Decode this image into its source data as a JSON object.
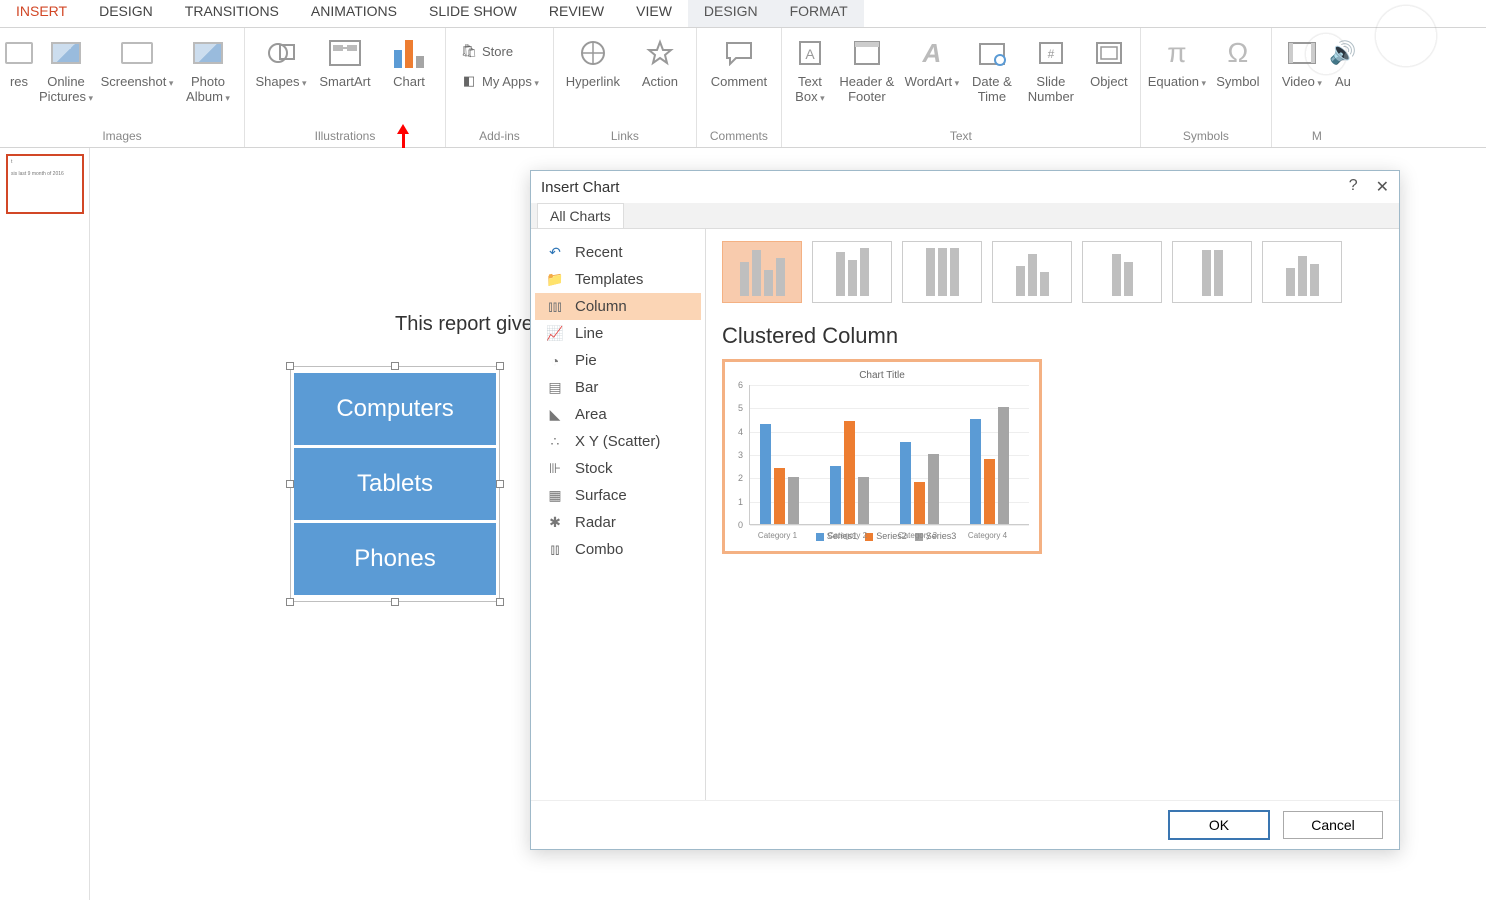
{
  "ribbon_tabs": [
    "INSERT",
    "DESIGN",
    "TRANSITIONS",
    "ANIMATIONS",
    "SLIDE SHOW",
    "REVIEW",
    "VIEW",
    "DESIGN",
    "FORMAT"
  ],
  "active_tab_index": 0,
  "contextual_tab_indices": [
    7,
    8
  ],
  "groups": {
    "images": {
      "label": "Images",
      "buttons": [
        "res",
        "Online Pictures",
        "Screenshot",
        "Photo Album"
      ]
    },
    "illustrations": {
      "label": "Illustrations",
      "buttons": [
        "Shapes",
        "SmartArt",
        "Chart"
      ]
    },
    "addins": {
      "label": "Add-ins",
      "store": "Store",
      "myapps": "My Apps"
    },
    "links": {
      "label": "Links",
      "buttons": [
        "Hyperlink",
        "Action"
      ]
    },
    "comments": {
      "label": "Comments",
      "buttons": [
        "Comment"
      ]
    },
    "text": {
      "label": "Text",
      "buttons": [
        "Text Box",
        "Header & Footer",
        "WordArt",
        "Date & Time",
        "Slide Number",
        "Object"
      ]
    },
    "symbols": {
      "label": "Symbols",
      "buttons": [
        "Equation",
        "Symbol"
      ]
    },
    "media": {
      "label": "M",
      "buttons": [
        "Video",
        "Au"
      ]
    }
  },
  "slide": {
    "body_text": "This report give",
    "smartart_items": [
      "Computers",
      "Tablets",
      "Phones"
    ]
  },
  "dialog": {
    "title": "Insert Chart",
    "help": "?",
    "tab": "All Charts",
    "categories": [
      "Recent",
      "Templates",
      "Column",
      "Line",
      "Pie",
      "Bar",
      "Area",
      "X Y (Scatter)",
      "Stock",
      "Surface",
      "Radar",
      "Combo"
    ],
    "selected_category_index": 2,
    "subtype_title": "Clustered Column",
    "ok": "OK",
    "cancel": "Cancel"
  },
  "chart_data": {
    "type": "bar",
    "title": "Chart Title",
    "categories": [
      "Category 1",
      "Category 2",
      "Category 3",
      "Category 4"
    ],
    "series": [
      {
        "name": "Series1",
        "color": "#5b9bd5",
        "values": [
          4.3,
          2.5,
          3.5,
          4.5
        ]
      },
      {
        "name": "Series2",
        "color": "#ed7d31",
        "values": [
          2.4,
          4.4,
          1.8,
          2.8
        ]
      },
      {
        "name": "Series3",
        "color": "#a5a5a5",
        "values": [
          2.0,
          2.0,
          3.0,
          5.0
        ]
      }
    ],
    "ylim": [
      0,
      6
    ],
    "yticks": [
      0,
      1,
      2,
      3,
      4,
      5,
      6
    ]
  }
}
